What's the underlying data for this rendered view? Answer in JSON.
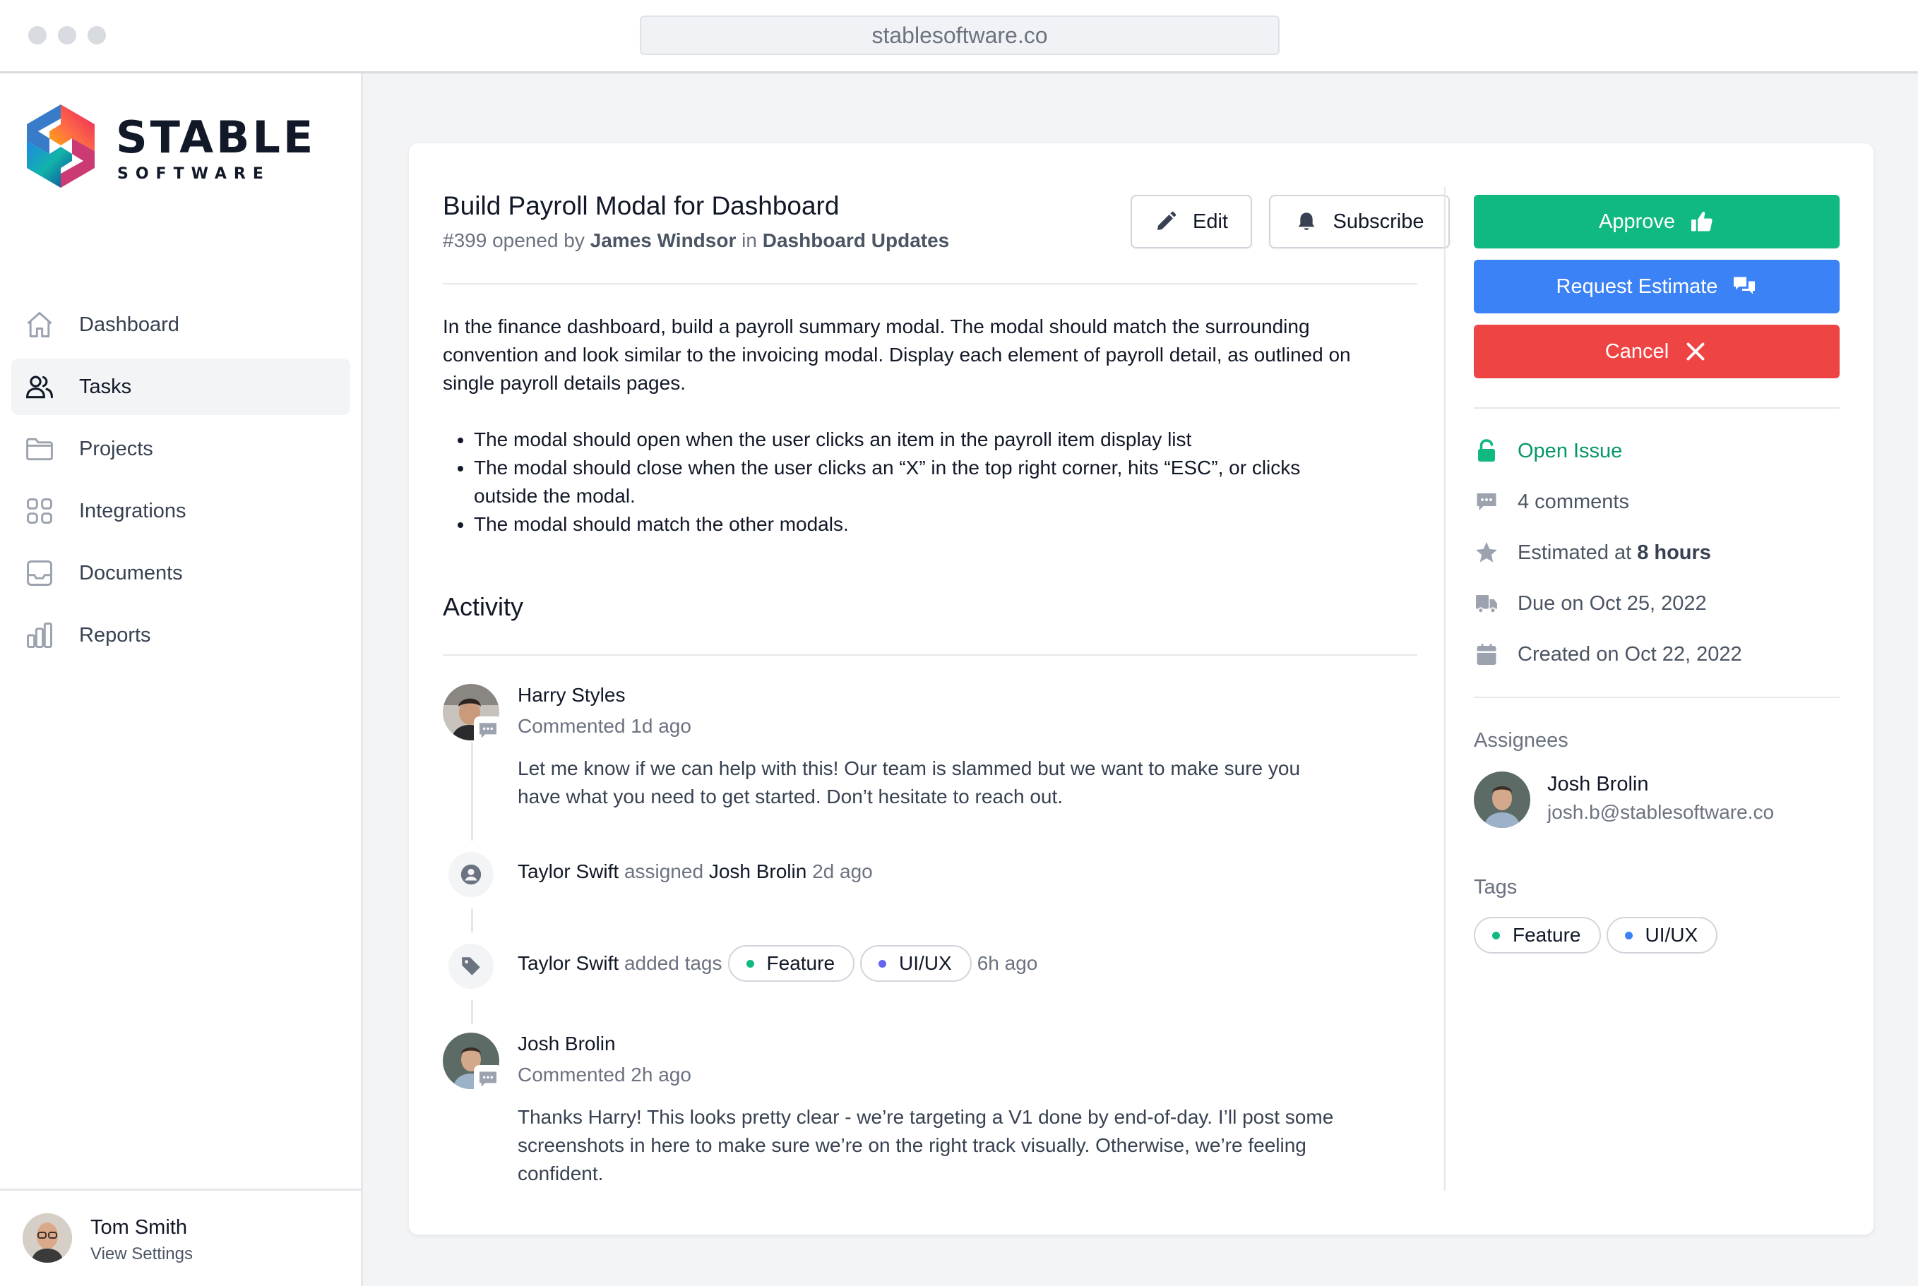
{
  "browser": {
    "url": "stablesoftware.co"
  },
  "brand": {
    "name": "STABLE",
    "sub": "SOFTWARE"
  },
  "sidebar": {
    "items": [
      {
        "label": "Dashboard",
        "icon": "home-icon",
        "active": false
      },
      {
        "label": "Tasks",
        "icon": "users-icon",
        "active": true
      },
      {
        "label": "Projects",
        "icon": "folder-icon",
        "active": false
      },
      {
        "label": "Integrations",
        "icon": "grid-icon",
        "active": false
      },
      {
        "label": "Documents",
        "icon": "inbox-icon",
        "active": false
      },
      {
        "label": "Reports",
        "icon": "bar-chart-icon",
        "active": false
      }
    ],
    "user": {
      "name": "Tom Smith",
      "action": "View Settings"
    }
  },
  "issue": {
    "title": "Build Payroll Modal for Dashboard",
    "number": "#399",
    "opened_by_label": "opened by",
    "author": "James Windsor",
    "in_label": "in",
    "project": "Dashboard Updates",
    "edit_label": "Edit",
    "subscribe_label": "Subscribe",
    "description": "In the finance dashboard, build a payroll summary modal. The modal should match the surrounding convention and look similar to the invoicing modal. Display each element of payroll detail, as outlined on single payroll details pages.",
    "bullets": [
      "The modal should open when the user clicks an item in the payroll item display list",
      "The modal should close when the user clicks an “X” in the top right corner, hits “ESC”, or clicks outside the modal.",
      "The modal should match the other modals."
    ]
  },
  "activity": {
    "heading": "Activity",
    "entries": [
      {
        "name": "Harry Styles",
        "meta": "Commented 1d ago",
        "body": "Let me know if we can help with this! Our team is slammed but we want to make sure you have what you need to get started. Don’t hesitate to reach out."
      },
      {
        "actor": "Taylor Swift",
        "verb": "assigned",
        "target": "Josh Brolin",
        "time": "2d ago"
      },
      {
        "actor": "Taylor Swift",
        "verb": "added tags",
        "tags": [
          "Feature",
          "UI/UX"
        ],
        "time": "6h ago"
      },
      {
        "name": "Josh Brolin",
        "meta": "Commented 2h ago",
        "body": "Thanks Harry! This looks pretty clear - we’re targeting a V1 done by end-of-day. I’ll post some screenshots in here to make sure we’re on the right track visually. Otherwise, we’re feeling confident."
      }
    ]
  },
  "actions": {
    "approve": "Approve",
    "request_estimate": "Request Estimate",
    "cancel": "Cancel"
  },
  "status": {
    "state": "Open Issue",
    "comments": "4 comments",
    "estimate_prefix": "Estimated at",
    "estimate_value": "8 hours",
    "due": "Due on Oct 25, 2022",
    "created": "Created on Oct 22, 2022"
  },
  "assignees": {
    "label": "Assignees",
    "name": "Josh Brolin",
    "email": "josh.b@stablesoftware.co"
  },
  "tags": {
    "label": "Tags",
    "items": [
      "Feature",
      "UI/UX"
    ]
  },
  "colors": {
    "approve": "#10b981",
    "request": "#3b82f6",
    "cancel": "#ef4444",
    "open_state": "#059669",
    "tag_feature": "#10b981",
    "tag_uiux": "#6366f1"
  }
}
